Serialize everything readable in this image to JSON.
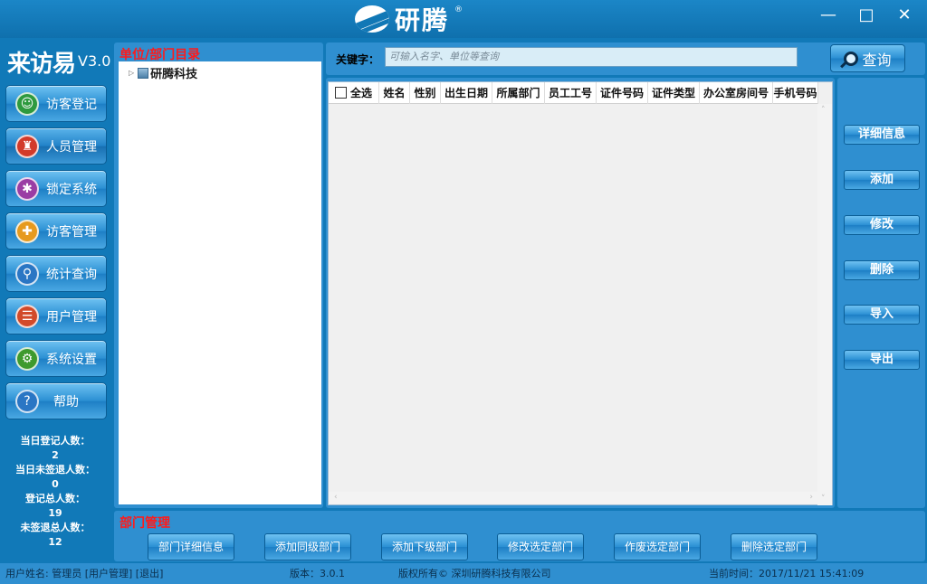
{
  "window": {
    "logo_text": "研腾",
    "logo_reg": "®",
    "minimize": "—",
    "maximize": "□",
    "close": "✕"
  },
  "app": {
    "name": "来访易",
    "version": "V3.0"
  },
  "nav": [
    {
      "label": "访客登记",
      "icon": "person-icon",
      "color": "#2e9a3e",
      "glyph": "☺"
    },
    {
      "label": "人员管理",
      "icon": "shirt-icon",
      "color": "#d23a2a",
      "glyph": "♜"
    },
    {
      "label": "锁定系统",
      "icon": "bug-icon",
      "color": "#9a3da4",
      "glyph": "✱"
    },
    {
      "label": "访客管理",
      "icon": "visitor-add-icon",
      "color": "#e69a1e",
      "glyph": "✚"
    },
    {
      "label": "统计查询",
      "icon": "magnifier-icon",
      "color": "#2a76c4",
      "glyph": "⚲"
    },
    {
      "label": "用户管理",
      "icon": "user-list-icon",
      "color": "#d24a2a",
      "glyph": "☰"
    },
    {
      "label": "系统设置",
      "icon": "gear-icon",
      "color": "#3e9a2e",
      "glyph": "⚙"
    },
    {
      "label": "帮助",
      "icon": "help-icon",
      "color": "#2a76c4",
      "glyph": "?"
    }
  ],
  "stats": {
    "today_label": "当日登记人数：",
    "today_value": "2",
    "today_unsigned_label": "当日未签退人数：",
    "today_unsigned_value": "0",
    "total_label": "登记总人数：",
    "total_value": "19",
    "total_unsigned_label": "未签退总人数：",
    "total_unsigned_value": "12"
  },
  "tree": {
    "title": "单位/部门目录",
    "root": "研腾科技"
  },
  "search": {
    "label": "关键字：",
    "placeholder": "可输入名字、单位等查询",
    "button": "查询"
  },
  "grid": {
    "columns": [
      "全选",
      "姓名",
      "性别",
      "出生日期",
      "所属部门",
      "员工工号",
      "证件号码",
      "证件类型",
      "办公室房间号",
      "手机号码"
    ]
  },
  "actions": [
    "详细信息",
    "添加",
    "修改",
    "删除",
    "导入",
    "导出"
  ],
  "dept": {
    "title": "部门管理",
    "buttons": [
      "部门详细信息",
      "添加同级部门",
      "添加下级部门",
      "修改选定部门",
      "作废选定部门",
      "删除选定部门"
    ]
  },
  "statusbar": {
    "user": "用户姓名: 管理员 [用户管理] [退出]",
    "version": "版本：3.0.1",
    "copyright": "版权所有© 深圳研腾科技有限公司",
    "time": "当前时间：2017/11/21 15:41:09"
  }
}
